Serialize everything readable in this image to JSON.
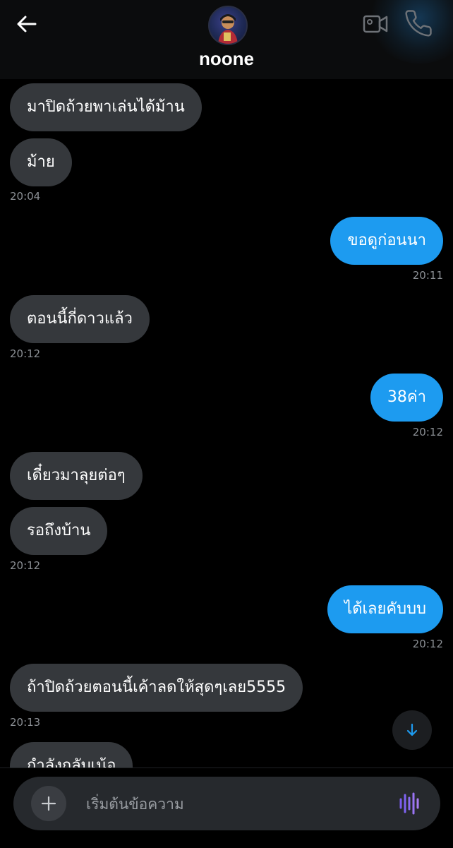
{
  "header": {
    "contact_name": "noone",
    "icons": {
      "back": "back-arrow-icon",
      "video": "video-call-icon",
      "call": "phone-icon"
    }
  },
  "messages": [
    {
      "dir": "in",
      "text": "มาปิดถ้วยพาเล่นได้ม้าน"
    },
    {
      "dir": "in",
      "text": "ม้าย",
      "time": "20:04"
    },
    {
      "dir": "out",
      "text": "ขอดูก่อนนา",
      "time": "20:11"
    },
    {
      "dir": "in",
      "text": "ตอนนี้กี่ดาวแล้ว",
      "time": "20:12"
    },
    {
      "dir": "out",
      "text": "38ค่า",
      "time": "20:12"
    },
    {
      "dir": "in",
      "text": "เดี๋ยวมาลุยต่อๆ"
    },
    {
      "dir": "in",
      "text": "รอถึงบ้าน",
      "time": "20:12"
    },
    {
      "dir": "out",
      "text": "ได้เลยคับบบ",
      "time": "20:12"
    },
    {
      "dir": "in",
      "text": "ถ้าปิดถ้วยตอนนี้เค้าลดให้สุดๆเลย5555",
      "time": "20:13"
    },
    {
      "dir": "in",
      "text": "กำลังกลับเน้อ"
    }
  ],
  "composer": {
    "placeholder": "เริ่มต้นข้อความ",
    "icons": {
      "add": "plus-icon",
      "voice": "voice-waveform-icon",
      "scroll": "arrow-down-icon"
    }
  },
  "colors": {
    "outgoing_bubble": "#1d9bf0",
    "incoming_bubble": "#35383c",
    "background": "#000000",
    "voice_accent": "#8b5cf6"
  }
}
